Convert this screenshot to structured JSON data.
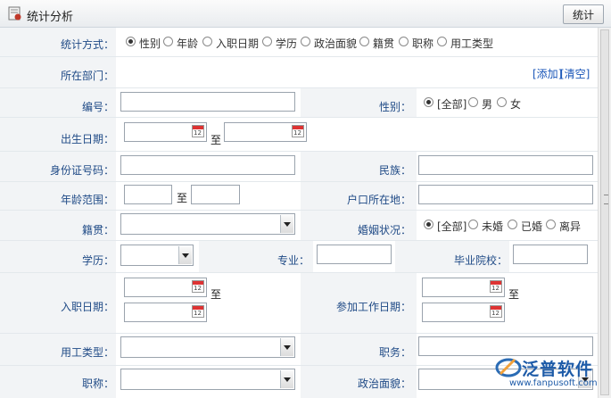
{
  "header": {
    "title": "统计分析",
    "stat_button": "统计"
  },
  "stat_method": {
    "label": "统计方式：",
    "options": [
      "性别",
      "年龄",
      "入职日期",
      "学历",
      "政治面貌",
      "籍贯",
      "职称",
      "用工类型"
    ],
    "selected": "性别"
  },
  "department": {
    "label": "所在部门：",
    "add_link": "[添加]",
    "clear_link": "[清空]"
  },
  "number": {
    "label": "编号：",
    "value": ""
  },
  "gender": {
    "label": "性别：",
    "options": [
      "[全部]",
      "男",
      "女"
    ],
    "selected": "[全部]"
  },
  "birth_date": {
    "label": "出生日期：",
    "to": "至"
  },
  "id_number": {
    "label": "身份证号码：",
    "value": ""
  },
  "ethnicity": {
    "label": "民族：",
    "value": ""
  },
  "age_range": {
    "label": "年龄范围：",
    "to": "至"
  },
  "hukou": {
    "label": "户口所在地：",
    "value": ""
  },
  "native_place": {
    "label": "籍贯：",
    "value": ""
  },
  "marital": {
    "label": "婚姻状况：",
    "options": [
      "[全部]",
      "未婚",
      "已婚",
      "离异"
    ],
    "selected": "[全部]"
  },
  "education": {
    "label": "学历：",
    "value": ""
  },
  "major": {
    "label": "专业：",
    "value": ""
  },
  "school": {
    "label": "毕业院校：",
    "value": ""
  },
  "hire_date": {
    "label": "入职日期：",
    "to": "至"
  },
  "work_start_date": {
    "label": "参加工作日期：",
    "to": "至"
  },
  "employment_type": {
    "label": "用工类型：",
    "value": ""
  },
  "position": {
    "label": "职务：",
    "value": ""
  },
  "title_rank": {
    "label": "职称：",
    "value": ""
  },
  "political": {
    "label": "政治面貌：",
    "value": ""
  },
  "watermark": {
    "name": "泛普软件",
    "url": "www.fanpusoft.com"
  }
}
